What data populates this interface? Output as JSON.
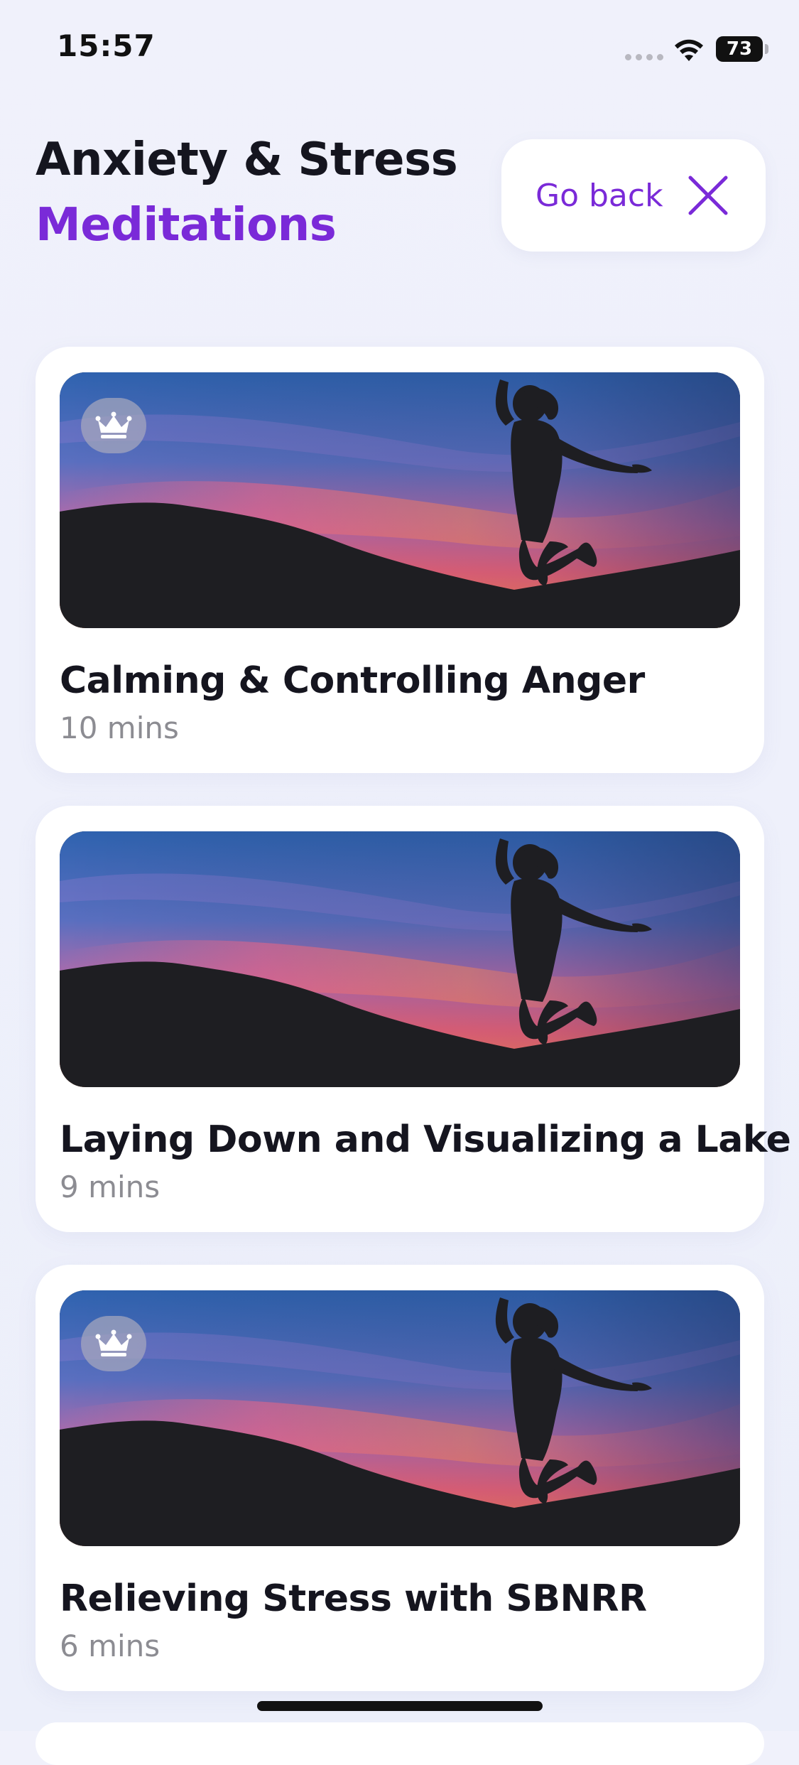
{
  "status_bar": {
    "time": "15:57",
    "battery_level": "73"
  },
  "header": {
    "title_line1": "Anxiety & Stress",
    "title_line2": "Meditations",
    "go_back_label": "Go back"
  },
  "meditations": [
    {
      "title": "Calming & Controlling Anger",
      "duration": "10 mins",
      "premium": true
    },
    {
      "title": "Laying Down and Visualizing a Lake",
      "duration": "9 mins",
      "premium": false
    },
    {
      "title": "Relieving Stress with SBNRR",
      "duration": "6 mins",
      "premium": true
    }
  ],
  "colors": {
    "accent": "#7a2ad8",
    "background": "#eef0fb",
    "card": "#ffffff",
    "title_text": "#15151f",
    "muted_text": "#8c8c92"
  },
  "icons": {
    "close": "close-icon",
    "premium": "crown-icon",
    "wifi": "wifi-icon",
    "battery": "battery-icon"
  }
}
